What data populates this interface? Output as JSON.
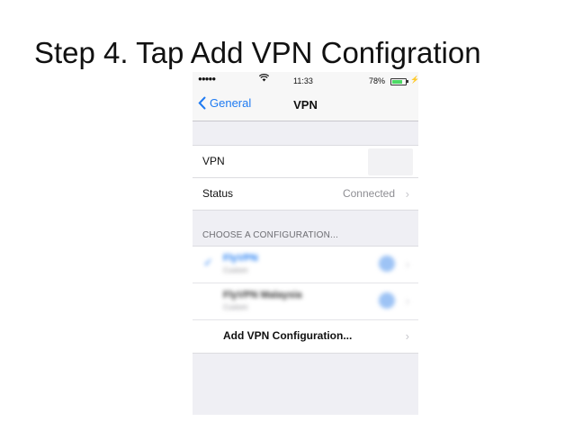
{
  "slide": {
    "title": "Step 4. Tap Add VPN Configration"
  },
  "status_bar": {
    "signal": "●●●●●",
    "time": "11:33",
    "battery_percent": "78%",
    "battery_level": 0.78
  },
  "nav": {
    "back_label": "General",
    "title": "VPN"
  },
  "vpn_group": {
    "vpn_label": "VPN",
    "status_label": "Status",
    "status_value": "Connected"
  },
  "configurations": {
    "header": "CHOOSE A CONFIGURATION...",
    "items": [
      {
        "name": "FlyVPN",
        "subtitle": "Custom",
        "selected": true
      },
      {
        "name": "FlyVPN Malaysia",
        "subtitle": "Custom",
        "selected": false
      }
    ],
    "add_label": "Add VPN Configuration..."
  },
  "icons": {
    "back": "chevron-left-icon",
    "chevron": "chevron-right-icon",
    "wifi": "wifi-icon",
    "battery": "battery-icon",
    "check": "checkmark-icon",
    "info": "info-icon"
  },
  "colors": {
    "accent": "#1f7bf2",
    "battery_fill": "#4cd964",
    "background": "#efeff4"
  }
}
